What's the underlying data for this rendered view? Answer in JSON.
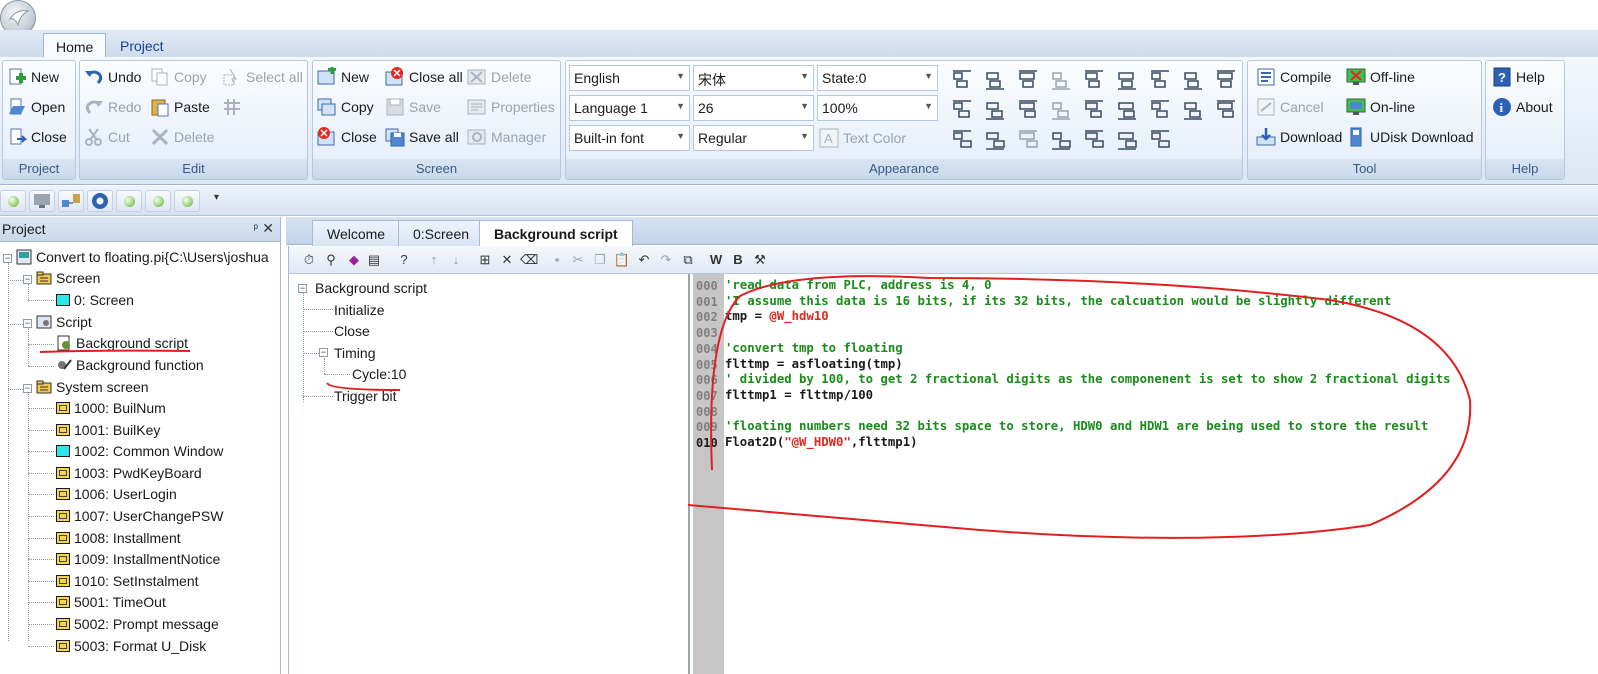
{
  "ribbon_tabs": [
    "Home",
    "Project"
  ],
  "groups": {
    "project": {
      "label": "Project",
      "new": "New",
      "open": "Open",
      "close": "Close"
    },
    "edit": {
      "label": "Edit",
      "undo": "Undo",
      "copy": "Copy",
      "select_all": "Select all",
      "redo": "Redo",
      "paste": "Paste",
      "cut": "Cut",
      "delete": "Delete"
    },
    "screen": {
      "label": "Screen",
      "new": "New",
      "close_all": "Close all",
      "delete": "Delete",
      "copy": "Copy",
      "save": "Save",
      "properties": "Properties",
      "close": "Close",
      "save_all": "Save all",
      "manager": "Manager"
    },
    "appearance": {
      "label": "Appearance",
      "language_select": "English",
      "font_select": "宋体",
      "state_select": "State:0",
      "language_index": "Language 1",
      "font_size": "26",
      "zoom": "100%",
      "font_type": "Built-in font",
      "font_style": "Regular",
      "text_color": "Text Color"
    },
    "tool": {
      "label": "Tool",
      "compile": "Compile",
      "offline": "Off-line",
      "cancel": "Cancel",
      "online": "On-line",
      "download": "Download",
      "udisk_download": "UDisk Download"
    },
    "help": {
      "label": "Help",
      "help": "Help",
      "about": "About"
    }
  },
  "project_panel": {
    "title": "Project",
    "pin": "ᵖ",
    "close": "✕",
    "root": "Convert to floating.pi{C:\\Users\\joshua",
    "screen_folder": "Screen",
    "screen_item": "0: Screen",
    "script_folder": "Script",
    "background_script": "Background script",
    "background_function": "Background function",
    "system_screen_folder": "System screen",
    "system_items": [
      "1000: BuilNum",
      "1001: BuilKey",
      "1002: Common Window",
      "1003: PwdKeyBoard",
      "1006: UserLogin",
      "1007: UserChangePSW",
      "1008: Installment",
      "1009: InstallmentNotice",
      "1010: SetInstalment",
      "5001: TimeOut",
      "5002: Prompt message",
      "5003: Format U_Disk"
    ]
  },
  "doc_tabs": [
    "Welcome",
    "0:Screen",
    "Background script"
  ],
  "script_tree": {
    "root": "Background script",
    "initialize": "Initialize",
    "close": "Close",
    "timing": "Timing",
    "cycle": "Cycle:10",
    "trigger": "Trigger bit"
  },
  "toolbar_text": {
    "w": "W",
    "b": "B",
    "help": "?"
  },
  "code": {
    "line_numbers": [
      "000",
      "001",
      "002",
      "003",
      "004",
      "005",
      "006",
      "007",
      "008",
      "009",
      "010"
    ],
    "lines": [
      [
        {
          "t": "'read data from PLC, address is 4, 0",
          "c": "com"
        }
      ],
      [
        {
          "t": "'I assume this data is 16 bits, if its 32 bits, the calcuation would be slightly different",
          "c": "com"
        }
      ],
      [
        {
          "t": "tmp = ",
          "c": "txt"
        },
        {
          "t": "@W_hdw10",
          "c": "var"
        }
      ],
      [],
      [
        {
          "t": "'convert tmp to floating",
          "c": "com"
        }
      ],
      [
        {
          "t": "flttmp = asfloating(tmp)",
          "c": "txt"
        }
      ],
      [
        {
          "t": "' divided by 100, to get 2 fractional digits as the componenent is set to show 2 fractional digits",
          "c": "com"
        }
      ],
      [
        {
          "t": "flttmp1 = flttmp/100",
          "c": "txt"
        }
      ],
      [],
      [
        {
          "t": "'floating numbers need 32 bits space to store, HDW0 and HDW1 are being used to store the result",
          "c": "com"
        }
      ],
      [
        {
          "t": "Float2D(",
          "c": "txt"
        },
        {
          "t": "\"@W_HDW0\"",
          "c": "var"
        },
        {
          "t": ",flttmp1)",
          "c": "txt"
        }
      ]
    ]
  },
  "colors": {
    "comment": "#1a8c1a",
    "variable": "#e0291f",
    "annotation": "#e02020",
    "ribbon_text": "#15428b"
  }
}
